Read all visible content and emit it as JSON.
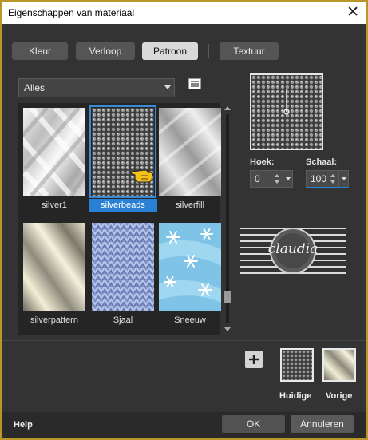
{
  "window": {
    "title": "Eigenschappen van materiaal",
    "close_glyph": "✕"
  },
  "tabs": [
    {
      "label": "Kleur",
      "active": false
    },
    {
      "label": "Verloop",
      "active": false
    },
    {
      "label": "Patroon",
      "active": true
    },
    {
      "label": "Textuur",
      "active": false
    }
  ],
  "category": {
    "selected": "Alles"
  },
  "patterns": [
    {
      "label": "silver1",
      "selected": false
    },
    {
      "label": "silverbeads",
      "selected": true
    },
    {
      "label": "silverfill",
      "selected": false
    },
    {
      "label": "silverpattern",
      "selected": false
    },
    {
      "label": "Sjaal",
      "selected": false
    },
    {
      "label": "Sneeuw",
      "selected": false
    }
  ],
  "angle": {
    "label": "Hoek:",
    "value": "0"
  },
  "scale": {
    "label": "Schaal:",
    "value": "100"
  },
  "logo": {
    "text": "claudia"
  },
  "swatches": {
    "current_label": "Huidige",
    "previous_label": "Vorige"
  },
  "footer": {
    "help": "Help",
    "ok": "OK",
    "cancel": "Annuleren"
  },
  "colors": {
    "accent": "#2a80d5",
    "frame": "#b8962a",
    "background": "#333333"
  }
}
